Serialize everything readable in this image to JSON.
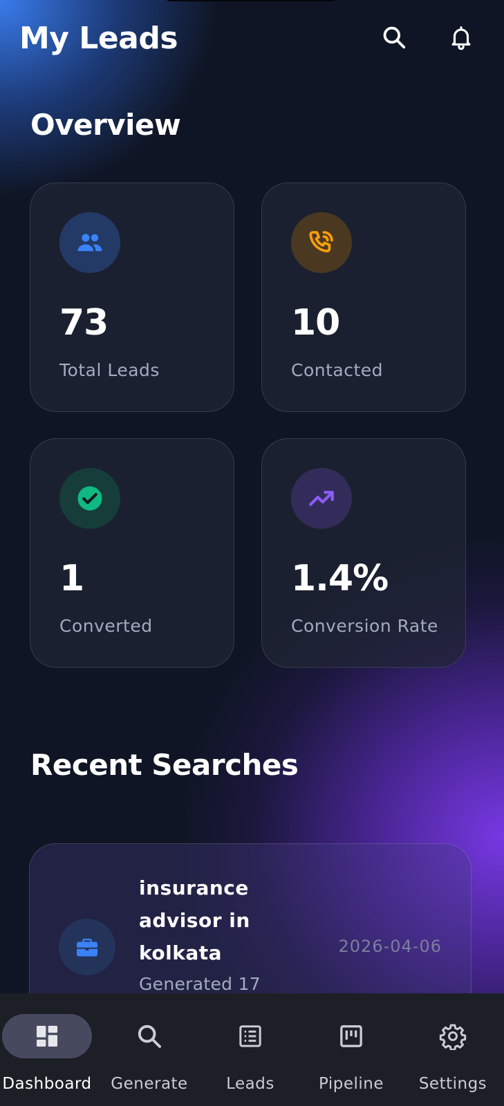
{
  "header": {
    "title": "My Leads",
    "search_icon": "search-icon",
    "notification_icon": "bell-icon"
  },
  "overview": {
    "title": "Overview",
    "cards": [
      {
        "icon": "people-icon",
        "value": "73",
        "label": "Total Leads",
        "accent": "#3b82f6"
      },
      {
        "icon": "phone-icon",
        "value": "10",
        "label": "Contacted",
        "accent": "#f59e0b"
      },
      {
        "icon": "check-circle-icon",
        "value": "1",
        "label": "Converted",
        "accent": "#10b981"
      },
      {
        "icon": "trending-up-icon",
        "value": "1.4%",
        "label": "Conversion Rate",
        "accent": "#8b5cf6"
      }
    ]
  },
  "recent_searches": {
    "title": "Recent Searches",
    "items": [
      {
        "icon": "briefcase-icon",
        "query": "insurance advisor in kolkata",
        "subtitle": "Generated 17",
        "date": "2026-04-06"
      }
    ]
  },
  "bottom_nav": {
    "active": "Dashboard",
    "items": [
      {
        "label": "Dashboard",
        "icon": "dashboard-icon"
      },
      {
        "label": "Generate",
        "icon": "search-icon"
      },
      {
        "label": "Leads",
        "icon": "list-icon"
      },
      {
        "label": "Pipeline",
        "icon": "kanban-icon"
      },
      {
        "label": "Settings",
        "icon": "gear-icon"
      }
    ]
  },
  "colors": {
    "background": "#0f1524",
    "blue_glow": "#3b82f6",
    "purple_glow": "#7c3aed",
    "nav_background": "#1d1f26",
    "nav_active_pill": "#474a5f"
  }
}
